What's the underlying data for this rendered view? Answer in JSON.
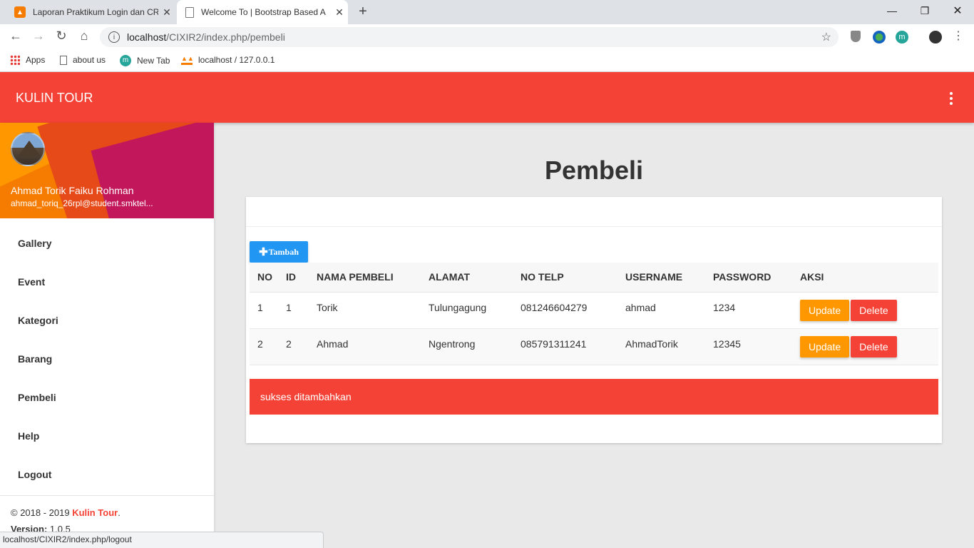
{
  "browser": {
    "tabs": [
      {
        "title": "Laporan Praktikum Login dan CR",
        "active": false
      },
      {
        "title": "Welcome To | Bootstrap Based A",
        "active": true
      }
    ],
    "url_host": "localhost",
    "url_path": "/CIXIR2/index.php/pembeli",
    "bookmarks": [
      "Apps",
      "about us",
      "New Tab",
      "localhost / 127.0.0.1"
    ],
    "status_url": "localhost/CIXIR2/index.php/logout"
  },
  "app": {
    "brand": "KULIN TOUR",
    "accent": "#f44336"
  },
  "user": {
    "name": "Ahmad Torik Faiku Rohman",
    "email": "ahmad_toriq_26rpl@student.smktel..."
  },
  "sidebar": {
    "items": [
      {
        "label": "Gallery"
      },
      {
        "label": "Event"
      },
      {
        "label": "Kategori"
      },
      {
        "label": "Barang"
      },
      {
        "label": "Pembeli"
      },
      {
        "label": "Help"
      },
      {
        "label": "Logout"
      }
    ],
    "footer": {
      "copyright": "© 2018 - 2019 ",
      "brand": "Kulin Tour",
      "dot": ".",
      "version_label": "Version:",
      "version": " 1.0.5"
    }
  },
  "main": {
    "title": "Pembeli",
    "add_label": "Tambah",
    "columns": [
      "NO",
      "ID",
      "NAMA PEMBELI",
      "ALAMAT",
      "NO TELP",
      "USERNAME",
      "PASSWORD",
      "AKSI"
    ],
    "rows": [
      {
        "no": "1",
        "id": "1",
        "nama": "Torik",
        "alamat": "Tulungagung",
        "telp": "081246604279",
        "username": "ahmad",
        "password": "1234"
      },
      {
        "no": "2",
        "id": "2",
        "nama": "Ahmad",
        "alamat": "Ngentrong",
        "telp": "085791311241",
        "username": "AhmadTorik",
        "password": "12345"
      }
    ],
    "update_label": "Update",
    "delete_label": "Delete",
    "alert": "sukses ditambahkan"
  }
}
